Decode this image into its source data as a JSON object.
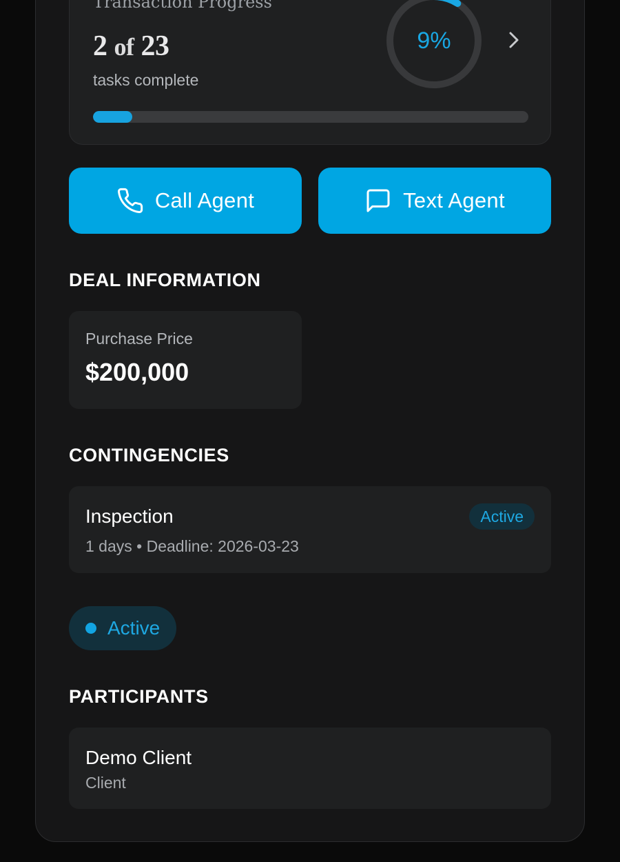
{
  "progress": {
    "title": "Transaction Progress",
    "completed": "2",
    "of_word": "of",
    "total": "23",
    "subtitle": "tasks complete",
    "percent_label": "9%",
    "percent_value": 0.09
  },
  "actions": {
    "call_label": "Call Agent",
    "text_label": "Text Agent"
  },
  "deal_information": {
    "section_title": "DEAL INFORMATION",
    "purchase_price_label": "Purchase Price",
    "purchase_price_value": "$200,000"
  },
  "contingencies": {
    "section_title": "CONTINGENCIES",
    "items": [
      {
        "name": "Inspection",
        "meta": "1 days • Deadline: 2026-03-23",
        "status": "Active"
      }
    ]
  },
  "deal_status": {
    "label": "Active"
  },
  "participants": {
    "section_title": "PARTICIPANTS",
    "items": [
      {
        "name": "Demo Client",
        "role": "Client"
      }
    ]
  },
  "colors": {
    "accent": "#00a6e3",
    "background": "#161617",
    "card": "#1f2021",
    "badge_bg": "#12303c"
  },
  "icons": {
    "call": "phone-icon",
    "text": "message-square-icon",
    "progress_chevron": "chevron-right-icon"
  }
}
